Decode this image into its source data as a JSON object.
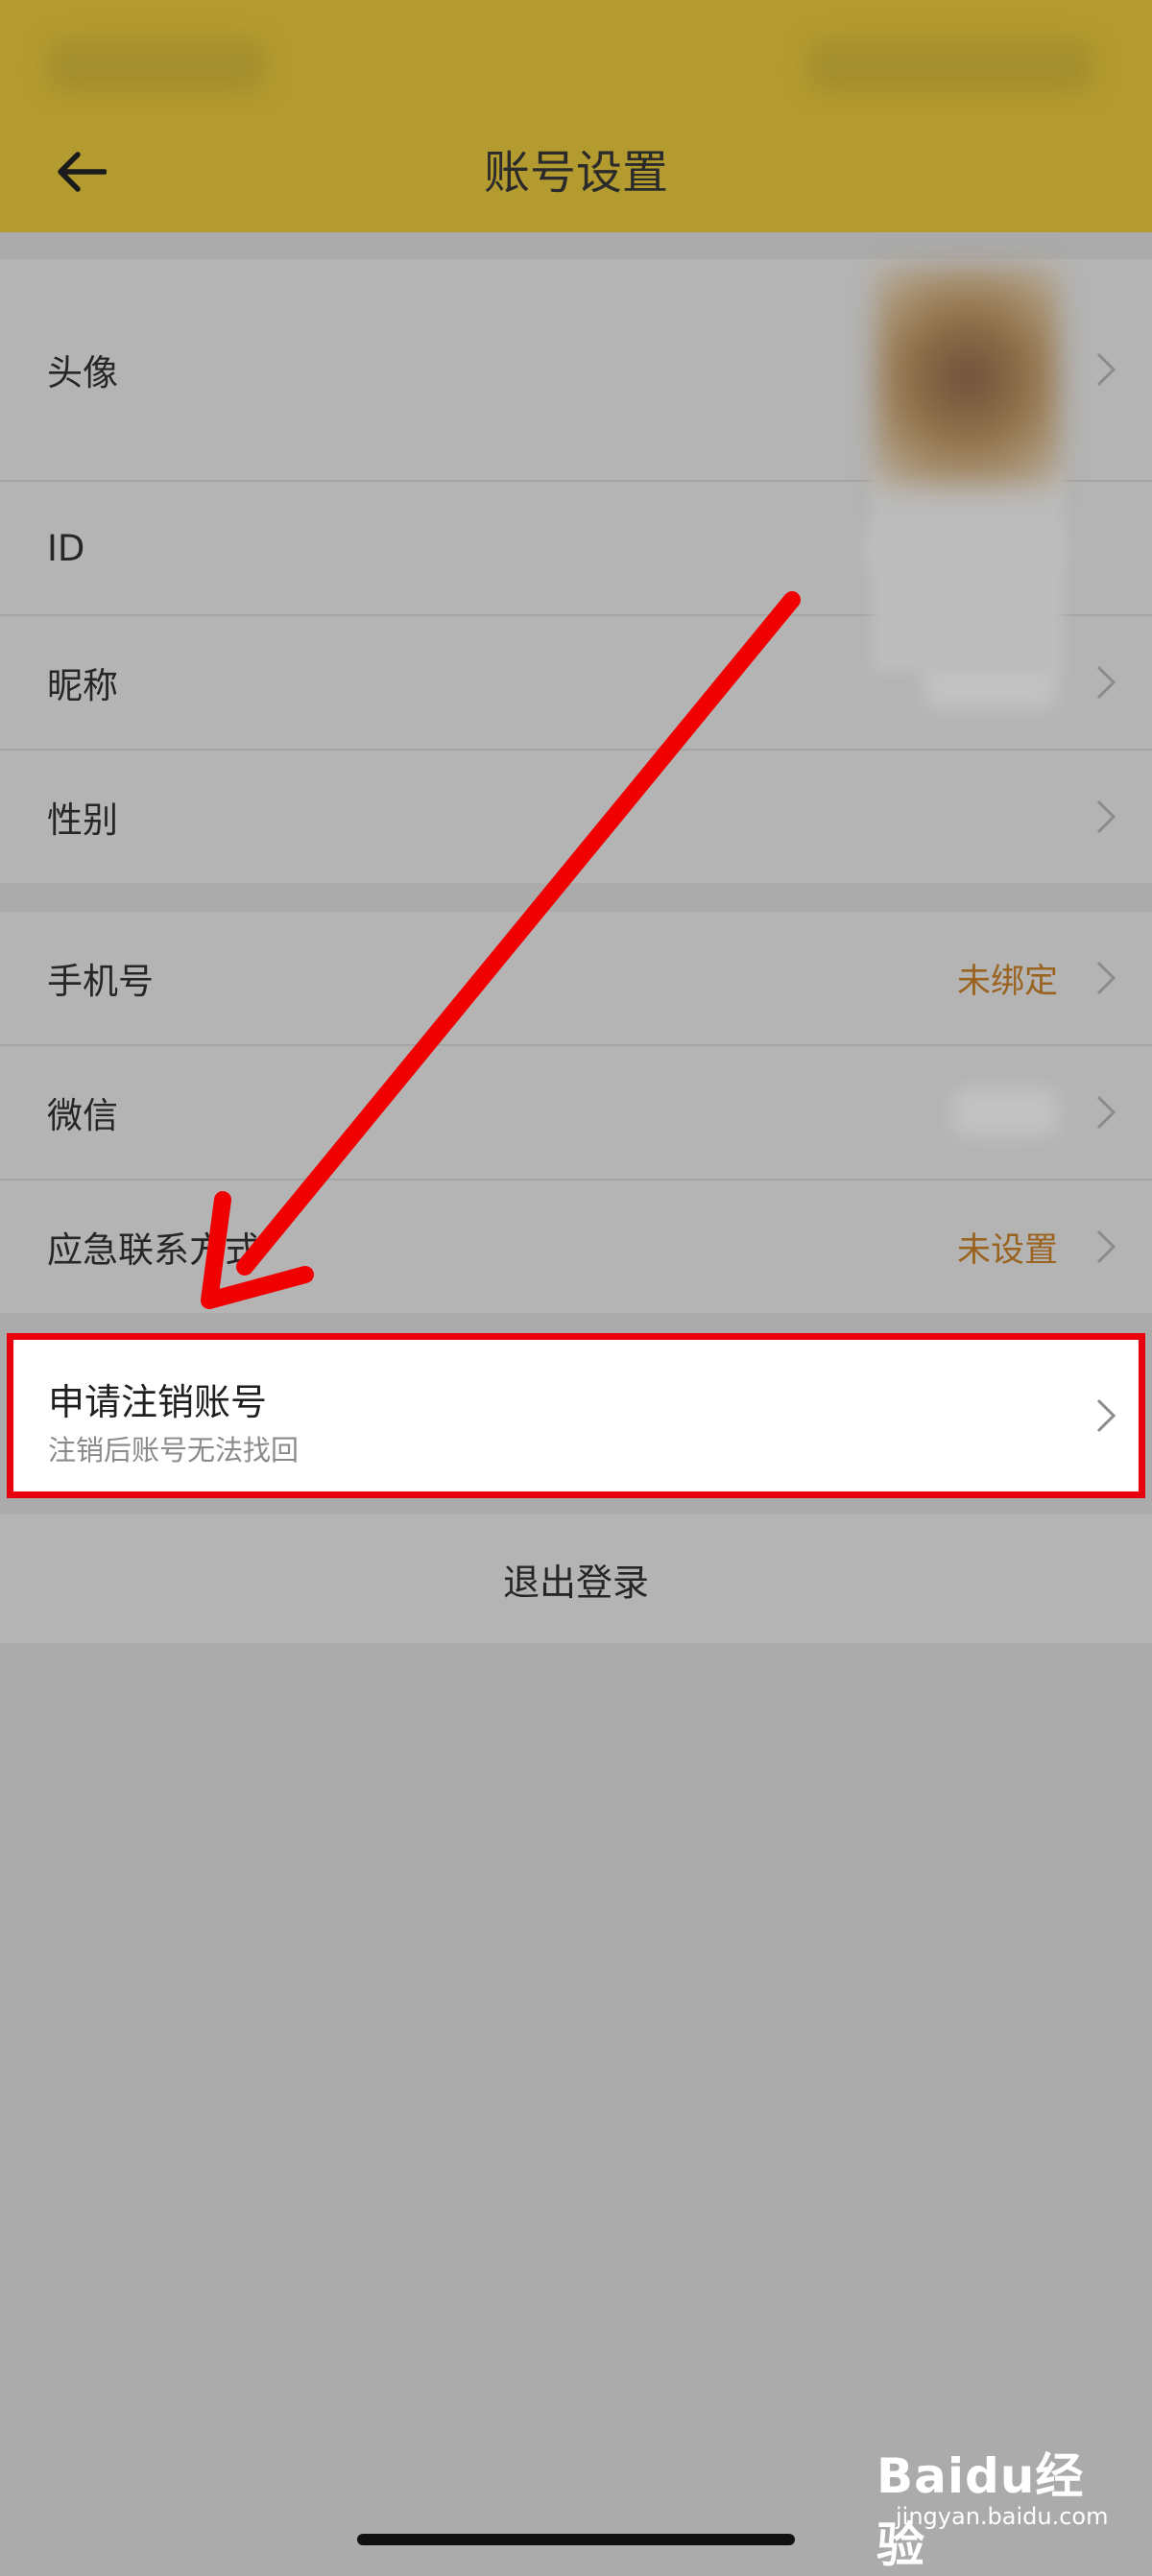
{
  "header": {
    "title": "账号设置"
  },
  "profile_section": {
    "avatar_label": "头像",
    "id_label": "ID",
    "nickname_label": "昵称",
    "gender_label": "性别"
  },
  "binding_section": {
    "phone_label": "手机号",
    "phone_value": "未绑定",
    "wechat_label": "微信",
    "emergency_label": "应急联系方式",
    "emergency_value": "未设置"
  },
  "deregister": {
    "title": "申请注销账号",
    "subtitle": "注销后账号无法找回"
  },
  "logout": {
    "label": "退出登录"
  },
  "watermark": {
    "brand": "Baidu经验",
    "url": "jingyan.baidu.com"
  },
  "colors": {
    "header_bg": "#b49b2f",
    "accent_orange": "#9a6320",
    "highlight_red": "#e8000d"
  }
}
